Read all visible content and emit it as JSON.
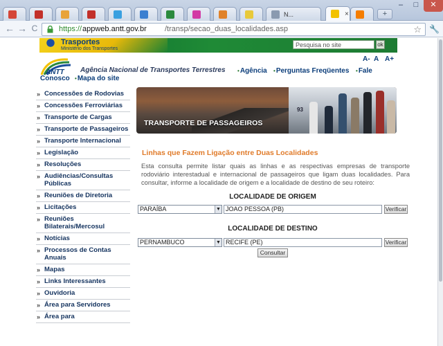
{
  "browser": {
    "tabs": [
      {
        "icon": "gmail-icon",
        "color": "#d44638",
        "text": ""
      },
      {
        "icon": "site-icon",
        "color": "#c2302a",
        "text": ""
      },
      {
        "icon": "bookmark-icon",
        "color": "#e8a33a",
        "text": ""
      },
      {
        "icon": "site-icon",
        "color": "#c2302a",
        "text": ""
      },
      {
        "icon": "twitter-icon",
        "color": "#3aa0e0",
        "text": ""
      },
      {
        "icon": "circle-app-icon",
        "color": "#3b7fd0",
        "text": ""
      },
      {
        "icon": "pen-icon",
        "color": "#2b8a3e",
        "text": ""
      },
      {
        "icon": "target-icon",
        "color": "#d23aa5",
        "text": ""
      },
      {
        "icon": "firefox-icon",
        "color": "#e0822a",
        "text": ""
      },
      {
        "icon": "star-icon",
        "color": "#e8c93a",
        "text": ""
      },
      {
        "icon": "page-icon",
        "color": "#8a9ab0",
        "text": "N..."
      },
      {
        "icon": "antt-icon",
        "color": "#f2c200",
        "text": "",
        "active": true
      },
      {
        "icon": "blogger-icon",
        "color": "#f57d00",
        "text": ""
      }
    ],
    "close_glyph": "×",
    "new_tab_glyph": "+",
    "window_controls": {
      "min": "–",
      "max": "□",
      "close": "✕"
    },
    "nav": {
      "back": "←",
      "forward": "→",
      "reload": "C"
    },
    "url": {
      "scheme": "https://",
      "host": "appweb.antt.gov.br",
      "path": "/transp/secao_duas_localidades.asp"
    },
    "star_glyph": "☆",
    "wrench_glyph": "🔧"
  },
  "header": {
    "gov_title": "Trasportes",
    "gov_subtitle": "Ministério dos Transportes",
    "search_placeholder": "Pesquisa no site",
    "search_ok": "ok",
    "logo_text": "ANTT",
    "agency_name": "Agência Nacional de Transportes Terrestres",
    "font_controls": [
      "A-",
      "A",
      "A+"
    ],
    "nav": [
      "Agência",
      "Perguntas Freqüentes",
      "Fale",
      "Conosco",
      "Mapa do site"
    ]
  },
  "sidebar": {
    "chevron": "»",
    "items": [
      "Concessões de Rodovias",
      "Concessões Ferroviárias",
      "Transporte de Cargas",
      "Transporte de Passageiros",
      "Transporte Internacional",
      "Legislação",
      "Resoluções",
      "Audiências/Consultas Públicas",
      "Reuniões de Diretoria",
      "Licitações",
      "Reuniões Bilaterais/Mercosul",
      "Notícias",
      "Processos de Contas Anuais",
      "Mapas",
      "Links Interessantes",
      "Ouvidoria",
      "Área para Servidores",
      "Área para"
    ]
  },
  "banner": {
    "title": "TRANSPORTE DE PASSAGEIROS",
    "bus_number": "93"
  },
  "content": {
    "heading": "Linhas que Fazem Ligação entre Duas Localidades",
    "description": "Esta consulta permite listar quais as linhas e as respectivas empresas de transporte rodoviário interestadual e internacional de passageiros que ligam duas localidades. Para consultar, informe a localidade de origem e a localidade de destino de seu roteiro:",
    "origin": {
      "title": "LOCALIDADE DE ORIGEM",
      "state": "PARAÍBA",
      "city": "JOAO PESSOA (PB)",
      "verify": "Verificar"
    },
    "destination": {
      "title": "LOCALIDADE DE DESTINO",
      "state": "PERNAMBUCO",
      "city": "RECIFE (PE)",
      "verify": "Verificar"
    },
    "select_arrow": "▼",
    "submit": "Consultar"
  }
}
